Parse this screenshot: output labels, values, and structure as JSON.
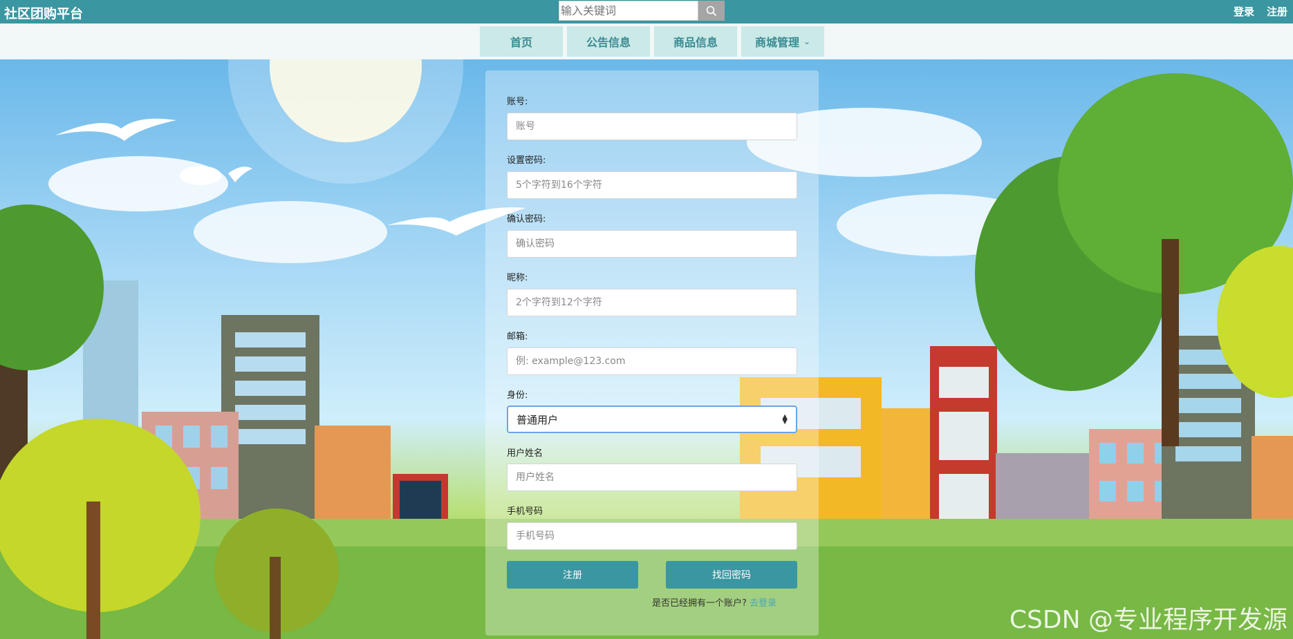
{
  "header": {
    "brand": "社区团购平台",
    "search_placeholder": "输入关键词",
    "login": "登录",
    "register": "注册"
  },
  "nav": {
    "items": [
      "首页",
      "公告信息",
      "商品信息",
      "商城管理"
    ]
  },
  "form": {
    "account_label": "账号:",
    "account_placeholder": "账号",
    "password_label": "设置密码:",
    "password_placeholder": "5个字符到16个字符",
    "confirm_label": "确认密码:",
    "confirm_placeholder": "确认密码",
    "nickname_label": "昵称:",
    "nickname_placeholder": "2个字符到12个字符",
    "email_label": "邮箱:",
    "email_placeholder": "例: example@123.com",
    "role_label": "身份:",
    "role_value": "普通用户",
    "realname_label": "用户姓名",
    "realname_placeholder": "用户姓名",
    "phone_label": "手机号码",
    "phone_placeholder": "手机号码",
    "register_button": "注册",
    "recover_button": "找回密码",
    "login_hint": "是否已经拥有一个账户?",
    "login_link": "去登录"
  },
  "watermark": "CSDN @专业程序开发源",
  "colors": {
    "primary": "#3a96a0",
    "nav_bg": "#cae9e7",
    "nav_text": "#3a8a92"
  }
}
